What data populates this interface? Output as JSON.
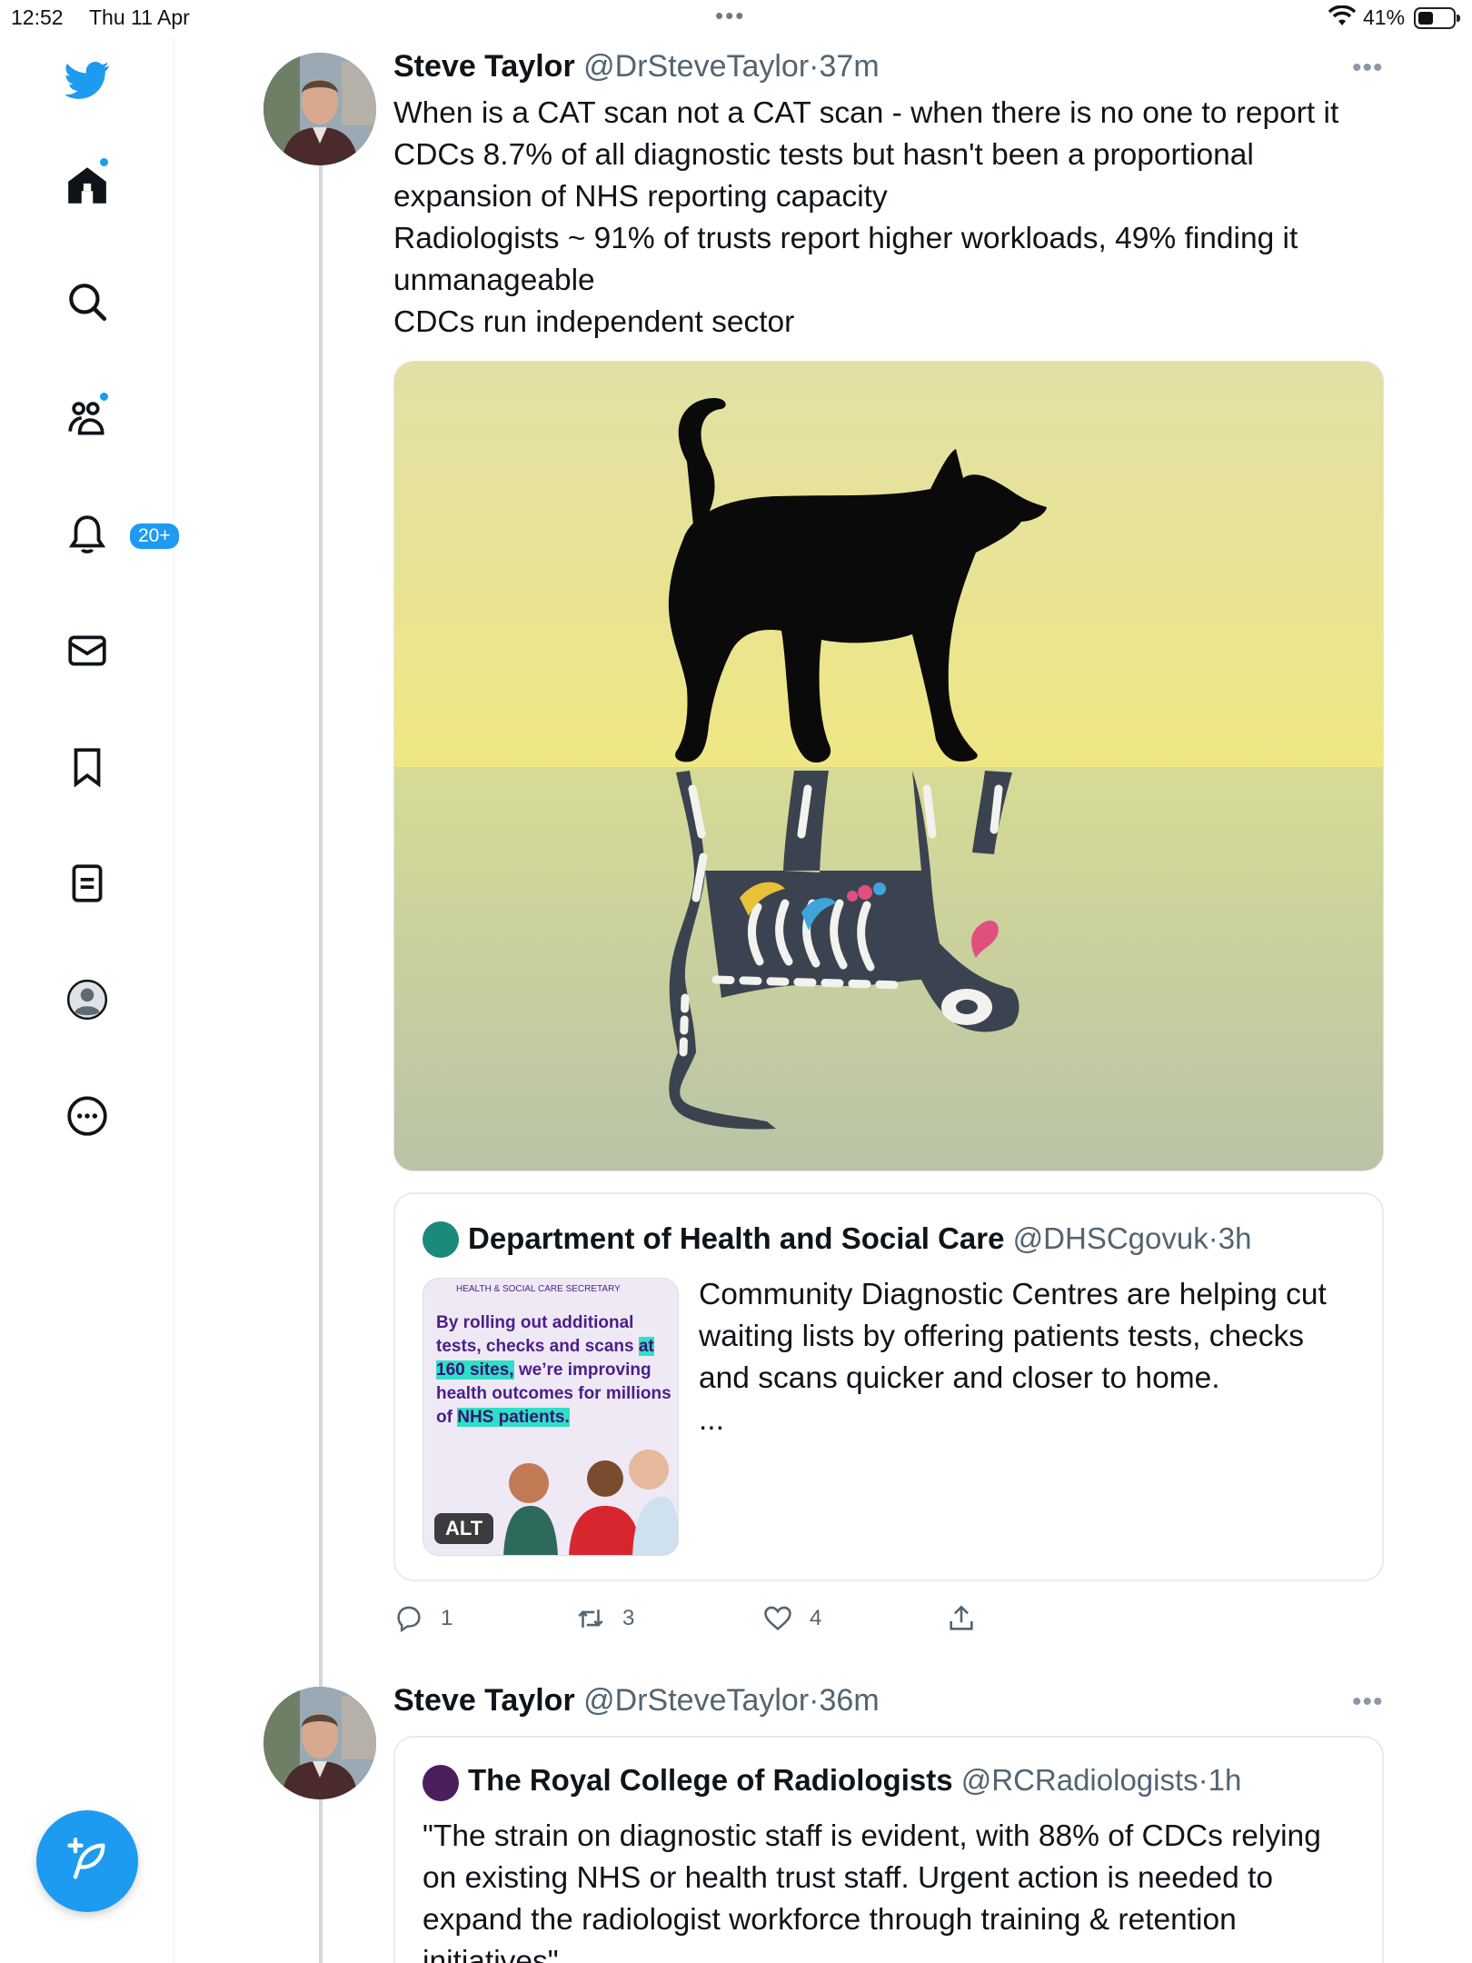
{
  "status_bar": {
    "time": "12:52",
    "date": "Thu 11 Apr",
    "battery": "41%"
  },
  "sidebar": {
    "items": [
      {
        "name": "twitter-logo",
        "icon": "bird-icon"
      },
      {
        "name": "home",
        "icon": "home-icon",
        "has_dot": true
      },
      {
        "name": "explore",
        "icon": "search-icon"
      },
      {
        "name": "communities",
        "icon": "people-icon",
        "has_dot": true
      },
      {
        "name": "notifications",
        "icon": "bell-icon",
        "badge": "20+"
      },
      {
        "name": "messages",
        "icon": "mail-icon"
      },
      {
        "name": "bookmarks",
        "icon": "bookmark-icon"
      },
      {
        "name": "lists",
        "icon": "list-icon"
      },
      {
        "name": "profile",
        "icon": "profile-icon"
      },
      {
        "name": "more",
        "icon": "more-circle-icon"
      }
    ],
    "notification_badge": "20+",
    "accent": "#1d9bf0"
  },
  "tweet1": {
    "name": "Steve Taylor",
    "handle": "@DrSteveTaylor",
    "sep": "·",
    "time": "37m",
    "more": "•••",
    "lines": [
      "When is a CAT scan not a CAT scan - when there is no one to report it",
      "CDCs 8.7% of all diagnostic tests but hasn't been a proportional",
      "expansion of NHS reporting capacity",
      "Radiologists ~ 91% of trusts report higher workloads, 49% finding it",
      "unmanageable",
      "CDCs run independent sector"
    ],
    "quote": {
      "name": "Department of Health and Social Care",
      "handle": "@DHSCgovuk",
      "sep": "·",
      "time": "3h",
      "thumb_header": "HEALTH & SOCIAL CARE SECRETARY",
      "thumb_alt": "ALT",
      "lines": [
        "Community Diagnostic Centres are helping cut",
        "waiting lists by offering patients tests, checks",
        "and scans quicker and closer to home.",
        "..."
      ]
    },
    "actions": {
      "replies": "1",
      "retweets": "3",
      "likes": "4"
    }
  },
  "tweet2": {
    "name": "Steve Taylor",
    "handle": "@DrSteveTaylor",
    "sep": "·",
    "time": "36m",
    "more": "•••",
    "quote": {
      "name": "The Royal College of Radiologists",
      "handle": "@RCRadiologists",
      "sep": "·",
      "time": "1h",
      "lines": [
        "\"The strain on diagnostic staff is evident, with 88% of CDCs relying",
        "on existing NHS or health trust staff. Urgent action is needed to",
        "expand the radiologist workforce through training & retention",
        "initiatives\""
      ]
    }
  }
}
